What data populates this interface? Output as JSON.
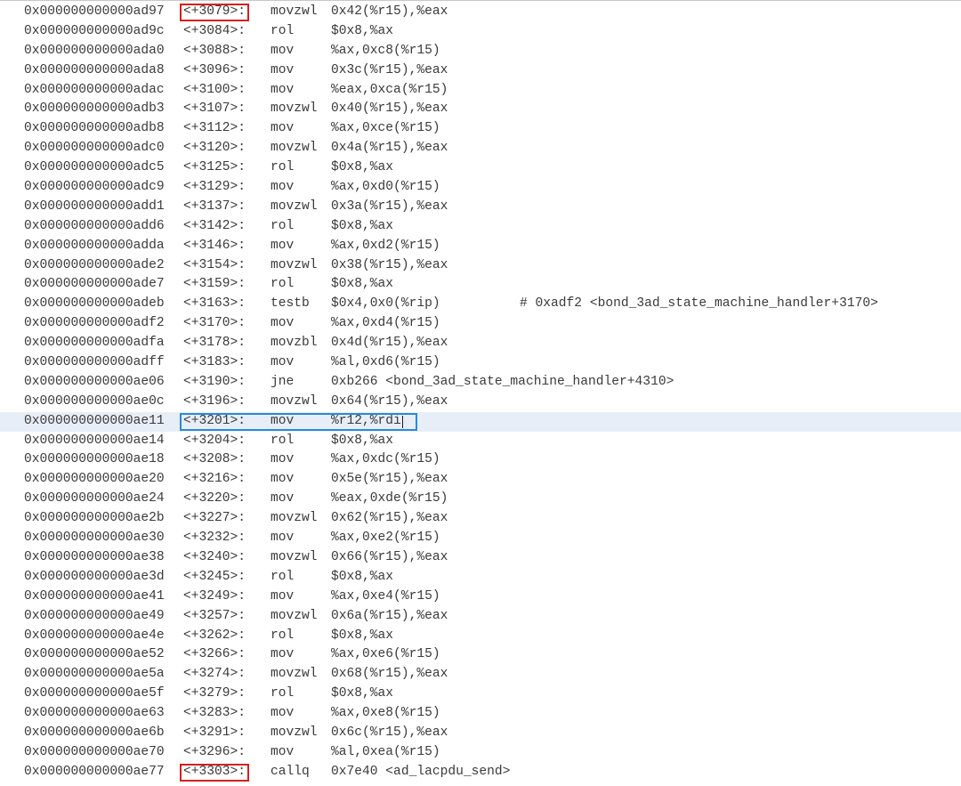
{
  "disassembly": {
    "lines": [
      {
        "address": "0x000000000000ad97",
        "offset": "<+3079>:",
        "mnemonic": "movzwl",
        "operands": "0x42(%r15),%eax",
        "comment": ""
      },
      {
        "address": "0x000000000000ad9c",
        "offset": "<+3084>:",
        "mnemonic": "rol",
        "operands": "$0x8,%ax",
        "comment": ""
      },
      {
        "address": "0x000000000000ada0",
        "offset": "<+3088>:",
        "mnemonic": "mov",
        "operands": "%ax,0xc8(%r15)",
        "comment": ""
      },
      {
        "address": "0x000000000000ada8",
        "offset": "<+3096>:",
        "mnemonic": "mov",
        "operands": "0x3c(%r15),%eax",
        "comment": ""
      },
      {
        "address": "0x000000000000adac",
        "offset": "<+3100>:",
        "mnemonic": "mov",
        "operands": "%eax,0xca(%r15)",
        "comment": ""
      },
      {
        "address": "0x000000000000adb3",
        "offset": "<+3107>:",
        "mnemonic": "movzwl",
        "operands": "0x40(%r15),%eax",
        "comment": ""
      },
      {
        "address": "0x000000000000adb8",
        "offset": "<+3112>:",
        "mnemonic": "mov",
        "operands": "%ax,0xce(%r15)",
        "comment": ""
      },
      {
        "address": "0x000000000000adc0",
        "offset": "<+3120>:",
        "mnemonic": "movzwl",
        "operands": "0x4a(%r15),%eax",
        "comment": ""
      },
      {
        "address": "0x000000000000adc5",
        "offset": "<+3125>:",
        "mnemonic": "rol",
        "operands": "$0x8,%ax",
        "comment": ""
      },
      {
        "address": "0x000000000000adc9",
        "offset": "<+3129>:",
        "mnemonic": "mov",
        "operands": "%ax,0xd0(%r15)",
        "comment": ""
      },
      {
        "address": "0x000000000000add1",
        "offset": "<+3137>:",
        "mnemonic": "movzwl",
        "operands": "0x3a(%r15),%eax",
        "comment": ""
      },
      {
        "address": "0x000000000000add6",
        "offset": "<+3142>:",
        "mnemonic": "rol",
        "operands": "$0x8,%ax",
        "comment": ""
      },
      {
        "address": "0x000000000000adda",
        "offset": "<+3146>:",
        "mnemonic": "mov",
        "operands": "%ax,0xd2(%r15)",
        "comment": ""
      },
      {
        "address": "0x000000000000ade2",
        "offset": "<+3154>:",
        "mnemonic": "movzwl",
        "operands": "0x38(%r15),%eax",
        "comment": ""
      },
      {
        "address": "0x000000000000ade7",
        "offset": "<+3159>:",
        "mnemonic": "rol",
        "operands": "$0x8,%ax",
        "comment": ""
      },
      {
        "address": "0x000000000000adeb",
        "offset": "<+3163>:",
        "mnemonic": "testb",
        "operands": "$0x4,0x0(%rip)",
        "comment": "# 0xadf2 <bond_3ad_state_machine_handler+3170>"
      },
      {
        "address": "0x000000000000adf2",
        "offset": "<+3170>:",
        "mnemonic": "mov",
        "operands": "%ax,0xd4(%r15)",
        "comment": ""
      },
      {
        "address": "0x000000000000adfa",
        "offset": "<+3178>:",
        "mnemonic": "movzbl",
        "operands": "0x4d(%r15),%eax",
        "comment": ""
      },
      {
        "address": "0x000000000000adff",
        "offset": "<+3183>:",
        "mnemonic": "mov",
        "operands": "%al,0xd6(%r15)",
        "comment": ""
      },
      {
        "address": "0x000000000000ae06",
        "offset": "<+3190>:",
        "mnemonic": "jne",
        "operands": "0xb266 <bond_3ad_state_machine_handler+4310>",
        "comment": ""
      },
      {
        "address": "0x000000000000ae0c",
        "offset": "<+3196>:",
        "mnemonic": "movzwl",
        "operands": "0x64(%r15),%eax",
        "comment": ""
      },
      {
        "address": "0x000000000000ae11",
        "offset": "<+3201>:",
        "mnemonic": "mov",
        "operands": "%r12,%rdi",
        "comment": ""
      },
      {
        "address": "0x000000000000ae14",
        "offset": "<+3204>:",
        "mnemonic": "rol",
        "operands": "$0x8,%ax",
        "comment": ""
      },
      {
        "address": "0x000000000000ae18",
        "offset": "<+3208>:",
        "mnemonic": "mov",
        "operands": "%ax,0xdc(%r15)",
        "comment": ""
      },
      {
        "address": "0x000000000000ae20",
        "offset": "<+3216>:",
        "mnemonic": "mov",
        "operands": "0x5e(%r15),%eax",
        "comment": ""
      },
      {
        "address": "0x000000000000ae24",
        "offset": "<+3220>:",
        "mnemonic": "mov",
        "operands": "%eax,0xde(%r15)",
        "comment": ""
      },
      {
        "address": "0x000000000000ae2b",
        "offset": "<+3227>:",
        "mnemonic": "movzwl",
        "operands": "0x62(%r15),%eax",
        "comment": ""
      },
      {
        "address": "0x000000000000ae30",
        "offset": "<+3232>:",
        "mnemonic": "mov",
        "operands": "%ax,0xe2(%r15)",
        "comment": ""
      },
      {
        "address": "0x000000000000ae38",
        "offset": "<+3240>:",
        "mnemonic": "movzwl",
        "operands": "0x66(%r15),%eax",
        "comment": ""
      },
      {
        "address": "0x000000000000ae3d",
        "offset": "<+3245>:",
        "mnemonic": "rol",
        "operands": "$0x8,%ax",
        "comment": ""
      },
      {
        "address": "0x000000000000ae41",
        "offset": "<+3249>:",
        "mnemonic": "mov",
        "operands": "%ax,0xe4(%r15)",
        "comment": ""
      },
      {
        "address": "0x000000000000ae49",
        "offset": "<+3257>:",
        "mnemonic": "movzwl",
        "operands": "0x6a(%r15),%eax",
        "comment": ""
      },
      {
        "address": "0x000000000000ae4e",
        "offset": "<+3262>:",
        "mnemonic": "rol",
        "operands": "$0x8,%ax",
        "comment": ""
      },
      {
        "address": "0x000000000000ae52",
        "offset": "<+3266>:",
        "mnemonic": "mov",
        "operands": "%ax,0xe6(%r15)",
        "comment": ""
      },
      {
        "address": "0x000000000000ae5a",
        "offset": "<+3274>:",
        "mnemonic": "movzwl",
        "operands": "0x68(%r15),%eax",
        "comment": ""
      },
      {
        "address": "0x000000000000ae5f",
        "offset": "<+3279>:",
        "mnemonic": "rol",
        "operands": "$0x8,%ax",
        "comment": ""
      },
      {
        "address": "0x000000000000ae63",
        "offset": "<+3283>:",
        "mnemonic": "mov",
        "operands": "%ax,0xe8(%r15)",
        "comment": ""
      },
      {
        "address": "0x000000000000ae6b",
        "offset": "<+3291>:",
        "mnemonic": "movzwl",
        "operands": "0x6c(%r15),%eax",
        "comment": ""
      },
      {
        "address": "0x000000000000ae70",
        "offset": "<+3296>:",
        "mnemonic": "mov",
        "operands": "%al,0xea(%r15)",
        "comment": ""
      },
      {
        "address": "0x000000000000ae77",
        "offset": "<+3303>:",
        "mnemonic": "callq",
        "operands": "0x7e40 <ad_lacpdu_send>",
        "comment": ""
      }
    ],
    "highlighted_row": 21,
    "red_boxed_rows": [
      0,
      39
    ],
    "blue_boxed_row": 21
  },
  "colors": {
    "text": "#3a3a3a",
    "highlight_row": "#e8eef8",
    "red_box": "#d42020",
    "blue_box": "#2a8ad8"
  }
}
